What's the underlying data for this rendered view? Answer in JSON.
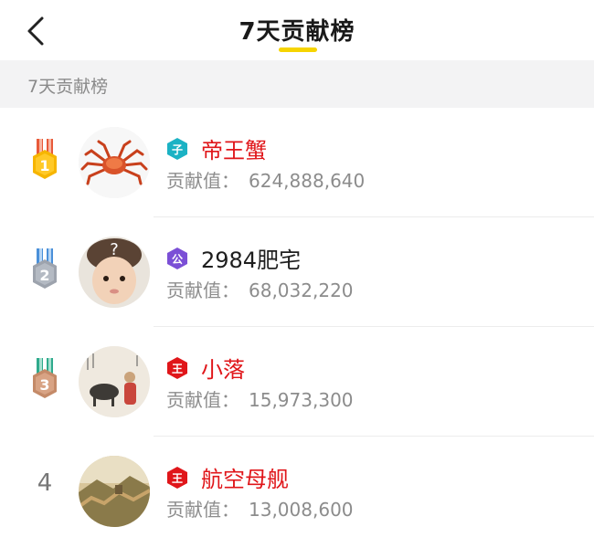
{
  "header": {
    "title": "7天贡献榜"
  },
  "section": {
    "label": "7天贡献榜"
  },
  "colors": {
    "accent_yellow": "#f6d400",
    "name_red": "#e0161a",
    "section_bg": "#f3f3f4"
  },
  "contribution_label": "贡献值：",
  "entries": [
    {
      "rank": "1",
      "name": "帝王蟹",
      "badge": "子",
      "value": "624,888,640",
      "medal": "gold-medal-icon",
      "avatar": "crab-avatar"
    },
    {
      "rank": "2",
      "name": "2984肥宅",
      "badge": "公",
      "value": "68,032,220",
      "medal": "silver-medal-icon",
      "avatar": "baby-avatar"
    },
    {
      "rank": "3",
      "name": "小落",
      "badge": "王",
      "value": "15,973,300",
      "medal": "bronze-medal-icon",
      "avatar": "painting-avatar"
    },
    {
      "rank": "4",
      "name": "航空母舰",
      "badge": "王",
      "value": "13,008,600",
      "medal": "",
      "avatar": "great-wall-avatar"
    }
  ]
}
